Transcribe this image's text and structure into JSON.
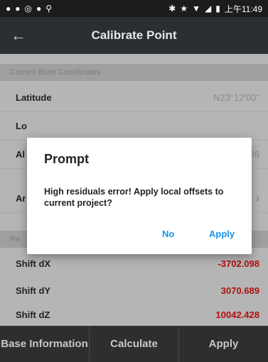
{
  "status_bar": {
    "icons_left": [
      "circle-icon",
      "circle-icon",
      "circle-icon",
      "circle-icon",
      "pin-icon"
    ],
    "icons_right": [
      "bluetooth-icon",
      "star-icon",
      "wifi-icon",
      "signal-icon",
      "battery-icon"
    ],
    "time": "上午11:49"
  },
  "app_bar": {
    "title": "Calibrate Point"
  },
  "section": {
    "label": "Current Base Coordinates"
  },
  "rows": {
    "latitude": {
      "label": "Latitude",
      "value": "N23°12'00\""
    },
    "longitude": {
      "label": "Lo",
      "value": ""
    },
    "altitude": {
      "label": "Al",
      "value": "26"
    },
    "antenna": {
      "label": "Ar"
    }
  },
  "residual_header": {
    "label": "Re"
  },
  "shifts": {
    "dx": {
      "label": "Shift dX",
      "value": "-3702.098"
    },
    "dy": {
      "label": "Shift dY",
      "value": "3070.689"
    },
    "dz": {
      "label": "Shift dZ",
      "value": "10042.428"
    }
  },
  "bottom_bar": {
    "base_information": "Base Information",
    "calculate": "Calculate",
    "apply": "Apply"
  },
  "dialog": {
    "title": "Prompt",
    "message": "High residuals error! Apply local offsets to current project?",
    "no_label": "No",
    "apply_label": "Apply",
    "accent": "#1a94e8"
  }
}
